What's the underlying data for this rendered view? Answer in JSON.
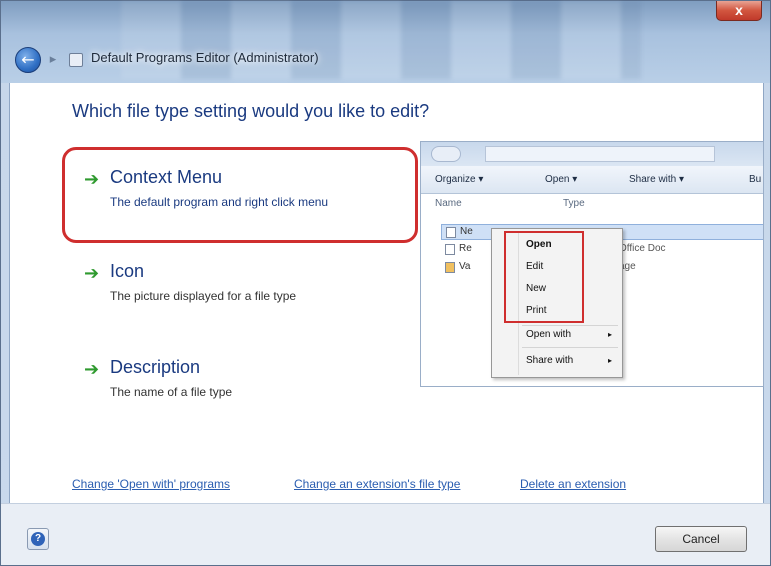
{
  "window": {
    "title": "Default Programs Editor (Administrator)",
    "close_label": "x"
  },
  "main": {
    "question": "Which file type setting would you like to edit?",
    "options": [
      {
        "title": "Context Menu",
        "description": "The default program and right click menu",
        "icon": "green-arrow-icon"
      },
      {
        "title": "Icon",
        "description": "The picture displayed for a file type",
        "icon": "green-arrow-icon"
      },
      {
        "title": "Description",
        "description": "The name of a file type",
        "icon": "green-arrow-icon"
      }
    ]
  },
  "preview": {
    "toolbar": [
      "Organize ▾",
      "Open ▾",
      "Share with ▾",
      "Bu"
    ],
    "columns": [
      "Name",
      "Type"
    ],
    "rows": [
      {
        "name": "Ne",
        "type": ""
      },
      {
        "name": "Re",
        "type": "Office Doc"
      },
      {
        "name": "Va",
        "type": "age"
      }
    ],
    "context_menu": [
      "Open",
      "Edit",
      "New",
      "Print",
      "Open with",
      "Share with"
    ]
  },
  "links": [
    "Change 'Open with' programs",
    "Change an extension's file type",
    "Delete an extension"
  ],
  "footer": {
    "help_label": "?",
    "cancel_label": "Cancel"
  },
  "colors": {
    "accent_text": "#1a3a80",
    "highlight_frame": "#cf2e2e",
    "arrow": "#2f9a2f",
    "link": "#2a5db0"
  }
}
